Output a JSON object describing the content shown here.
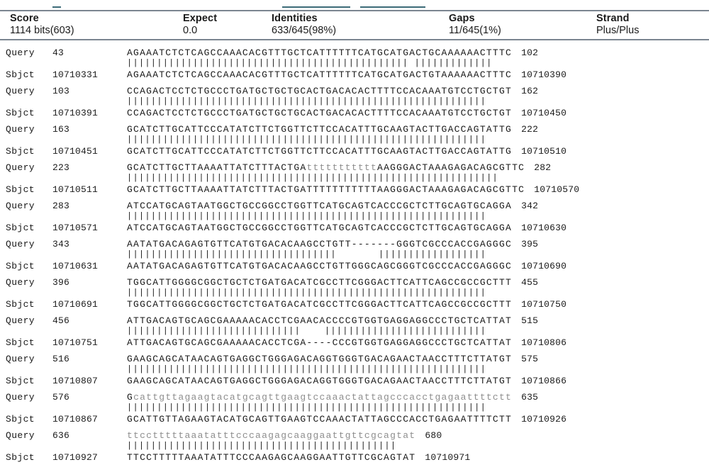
{
  "header": {
    "columns": [
      {
        "name": "score",
        "label": "Score",
        "value": "1114 bits(603)"
      },
      {
        "name": "expect",
        "label": "Expect",
        "value": "0.0"
      },
      {
        "name": "identities",
        "label": "Identities",
        "value": "633/645(98%)"
      },
      {
        "name": "gaps",
        "label": "Gaps",
        "value": "11/645(1%)"
      },
      {
        "name": "strand",
        "label": "Strand",
        "value": "Plus/Plus"
      }
    ]
  },
  "labels": {
    "query": "Query",
    "sbjct": "Sbjct"
  },
  "alignment": {
    "blocks": [
      {
        "query_start": "43",
        "query_seq": "AGAAATCTCTCAGCCAAACACGTTTGCTCATTTTTTCATGCATGACTGCAAAAAACTTTC",
        "query_end": "102",
        "midline": "||||||||||||||||||||||||||||||||||||||||||||||| |||||||||||||",
        "sbjct_start": "10710331",
        "sbjct_seq": "AGAAATCTCTCAGCCAAACACGTTTGCTCATTTTTTCATGCATGACTGTAAAAAACTTTC",
        "sbjct_end": "10710390",
        "query_masked_from": -1,
        "query_masked_to": -1
      },
      {
        "query_start": "103",
        "query_seq": "CCAGACTCCTCTGCCCTGATGCTGCTGCACTGACACACTTTTCCACAAATGTCCTGCTGT",
        "query_end": "162",
        "midline": "||||||||||||||||||||||||||||||||||||||||||||||||||||||||||||",
        "sbjct_start": "10710391",
        "sbjct_seq": "CCAGACTCCTCTGCCCTGATGCTGCTGCACTGACACACTTTTCCACAAATGTCCTGCTGT",
        "sbjct_end": "10710450",
        "query_masked_from": -1,
        "query_masked_to": -1
      },
      {
        "query_start": "163",
        "query_seq": "GCATCTTGCATTCCCATATCTTCTGGTTCTTCCACATTTGCAAGTACTTGACCAGTATTG",
        "query_end": "222",
        "midline": "||||||||||||||||||||||||||||||||||||||||||||||||||||||||||||",
        "sbjct_start": "10710451",
        "sbjct_seq": "GCATCTTGCATTCCCATATCTTCTGGTTCTTCCACATTTGCAAGTACTTGACCAGTATTG",
        "sbjct_end": "10710510",
        "query_masked_from": -1,
        "query_masked_to": -1
      },
      {
        "query_start": "223",
        "query_seq": "GCATCTTGCTTAAAATTATCTTTACTGAtttttttttttAAGGGACTAAAGAGACAGCGTTC",
        "query_end": "282",
        "midline": "||||||||||||||||||||||||||||||||||||||||||||||||||||||||||||||",
        "sbjct_start": "10710511",
        "sbjct_seq": "GCATCTTGCTTAAAATTATCTTTACTGATTTTTTTTTTTAAGGGACTAAAGAGACAGCGTTC",
        "sbjct_end": "10710570",
        "query_masked_from": 28,
        "query_masked_to": 39
      },
      {
        "query_start": "283",
        "query_seq": "ATCCATGCAGTAATGGCTGCCGGCCTGGTTCATGCAGTCACCCGCTCTTGCAGTGCAGGA",
        "query_end": "342",
        "midline": "||||||||||||||||||||||||||||||||||||||||||||||||||||||||||||",
        "sbjct_start": "10710571",
        "sbjct_seq": "ATCCATGCAGTAATGGCTGCCGGCCTGGTTCATGCAGTCACCCGCTCTTGCAGTGCAGGA",
        "sbjct_end": "10710630",
        "query_masked_from": -1,
        "query_masked_to": -1
      },
      {
        "query_start": "343",
        "query_seq": "AATATGACAGAGTGTTCATGTGACACAAGCCTGTT-------GGGTCGCCCACCGAGGGC",
        "query_end": "395",
        "midline": "|||||||||||||||||||||||||||||||||||       ||||||||||||||||||",
        "sbjct_start": "10710631",
        "sbjct_seq": "AATATGACAGAGTGTTCATGTGACACAAGCCTGTTGGGCAGCGGGTCGCCCACCGAGGGC",
        "sbjct_end": "10710690",
        "query_masked_from": -1,
        "query_masked_to": -1
      },
      {
        "query_start": "396",
        "query_seq": "TGGCATTGGGGCGGCTGCTCTGATGACATCGCCTTCGGGACTTCATTCAGCCGCCGCTTT",
        "query_end": "455",
        "midline": "||||||||||||||||||||||||||||||||||||||||||||||||||||||||||||",
        "sbjct_start": "10710691",
        "sbjct_seq": "TGGCATTGGGGCGGCTGCTCTGATGACATCGCCTTCGGGACTTCATTCAGCCGCCGCTTT",
        "sbjct_end": "10710750",
        "query_masked_from": -1,
        "query_masked_to": -1
      },
      {
        "query_start": "456",
        "query_seq": "ATTGACAGTGCAGCGAAAAACACCTCGAACACCCCGTGGTGAGGAGGCCCTGCTCATTAT",
        "query_end": "515",
        "midline": "|||||||||||||||||||||||||||||    |||||||||||||||||||||||||||",
        "sbjct_start": "10710751",
        "sbjct_seq": "ATTGACAGTGCAGCGAAAAACACCTCGA----CCCGTGGTGAGGAGGCCCTGCTCATTAT",
        "sbjct_end": "10710806",
        "query_masked_from": -1,
        "query_masked_to": -1
      },
      {
        "query_start": "516",
        "query_seq": "GAAGCAGCATAACAGTGAGGCTGGGAGACAGGTGGGTGACAGAACTAACCTTTCTTATGT",
        "query_end": "575",
        "midline": "||||||||||||||||||||||||||||||||||||||||||||||||||||||||||||",
        "sbjct_start": "10710807",
        "sbjct_seq": "GAAGCAGCATAACAGTGAGGCTGGGAGACAGGTGGGTGACAGAACTAACCTTTCTTATGT",
        "sbjct_end": "10710866",
        "query_masked_from": -1,
        "query_masked_to": -1
      },
      {
        "query_start": "576",
        "query_seq": "Gcattgttagaagtacatgcagttgaagtccaaactattagcccacctgagaattttctt",
        "query_end": "635",
        "midline": "||||||||||||||||||||||||||||||||||||||||||||||||||||||||||||",
        "sbjct_start": "10710867",
        "sbjct_seq": "GCATTGTTAGAAGTACATGCAGTTGAAGTCCAAACTATTAGCCCACCTGAGAATTTTCTT",
        "sbjct_end": "10710926",
        "query_masked_from": 1,
        "query_masked_to": 60
      },
      {
        "query_start": "636",
        "query_seq": "ttcctttttaaatatttcccaagagcaaggaattgttcgcagtat",
        "query_end": "680",
        "midline": "|||||||||||||||||||||||||||||||||||||||||||||",
        "sbjct_start": "10710927",
        "sbjct_seq": "TTCCTTTTTAAATATTTCCCAAGAGCAAGGAATTGTTCGCAGTAT",
        "sbjct_end": "10710971",
        "query_masked_from": 0,
        "query_masked_to": 45
      }
    ]
  },
  "colors": {
    "rule": "#7b8590",
    "link_stub": "#3c6b78",
    "masked_text": "#8e8e8e",
    "text": "#1a1a1a"
  }
}
